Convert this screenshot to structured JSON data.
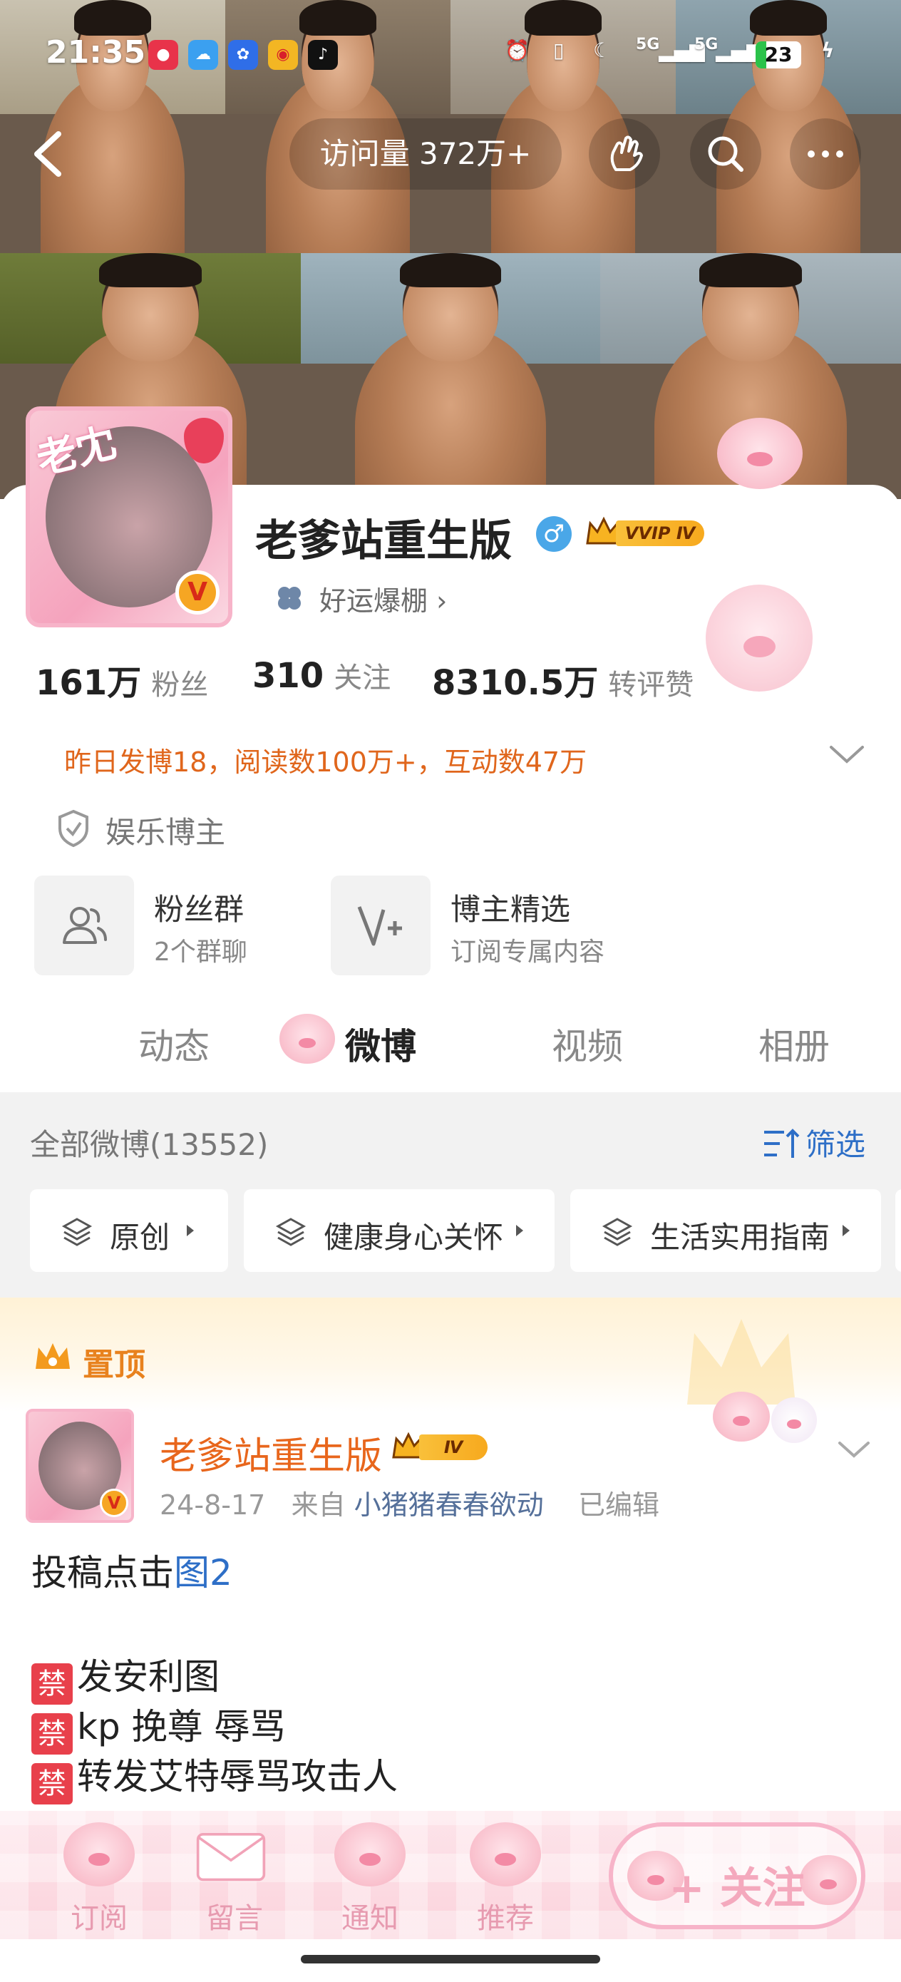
{
  "status_bar": {
    "time": "21:35",
    "network_1": "5G",
    "network_2": "5G",
    "battery": "23",
    "battery_level": 0.23
  },
  "nav": {
    "visits": "访问量 372万+"
  },
  "profile": {
    "avatar_text": "老冘",
    "avatar_badge": "V",
    "name": "老爹站重生版",
    "gender_symbol": "♂",
    "vip_badge": "VVIP Ⅳ",
    "luck_tag": "好运爆棚 ›",
    "stats": [
      {
        "value": "161万",
        "label": "粉丝"
      },
      {
        "value": "310",
        "label": "关注"
      },
      {
        "value": "8310.5万",
        "label": "转评赞"
      }
    ],
    "summary": "昨日发博18，阅读数100万+，互动数47万",
    "category": "娱乐博主",
    "features": [
      {
        "title": "粉丝群",
        "subtitle": "2个群聊",
        "icon": "group-icon"
      },
      {
        "title": "博主精选",
        "subtitle": "订阅专属内容",
        "icon": "v-plus-icon"
      }
    ]
  },
  "tabs": [
    "动态",
    "微博",
    "视频",
    "相册"
  ],
  "active_tab": 1,
  "filter": {
    "all_label": "全部微博(13552)",
    "filter_label": "筛选",
    "chips": [
      "原创",
      "健康身心关怀",
      "生活实用指南"
    ]
  },
  "pinned": {
    "label": "置顶"
  },
  "post": {
    "author": "老爹站重生版",
    "vip_badge": "Ⅳ",
    "date": "24-8-17",
    "from_label": "来自",
    "source": "小猪猪春春欲动",
    "edited": "已编辑",
    "body_prefix": "投稿点击",
    "body_link": "图2",
    "ban_tag": "禁",
    "rules": [
      "发安利图",
      "kp 挽尊 辱骂",
      "转发艾特辱骂攻击人"
    ]
  },
  "bottom_bar": {
    "items": [
      "订阅",
      "留言",
      "通知",
      "推荐"
    ],
    "follow_label": "+ 关注"
  },
  "colors": {
    "accent_orange": "#e8661c",
    "link_blue": "#2e6fc7",
    "vip_gold": "#f7a91e",
    "pink": "#f7b4c9"
  }
}
